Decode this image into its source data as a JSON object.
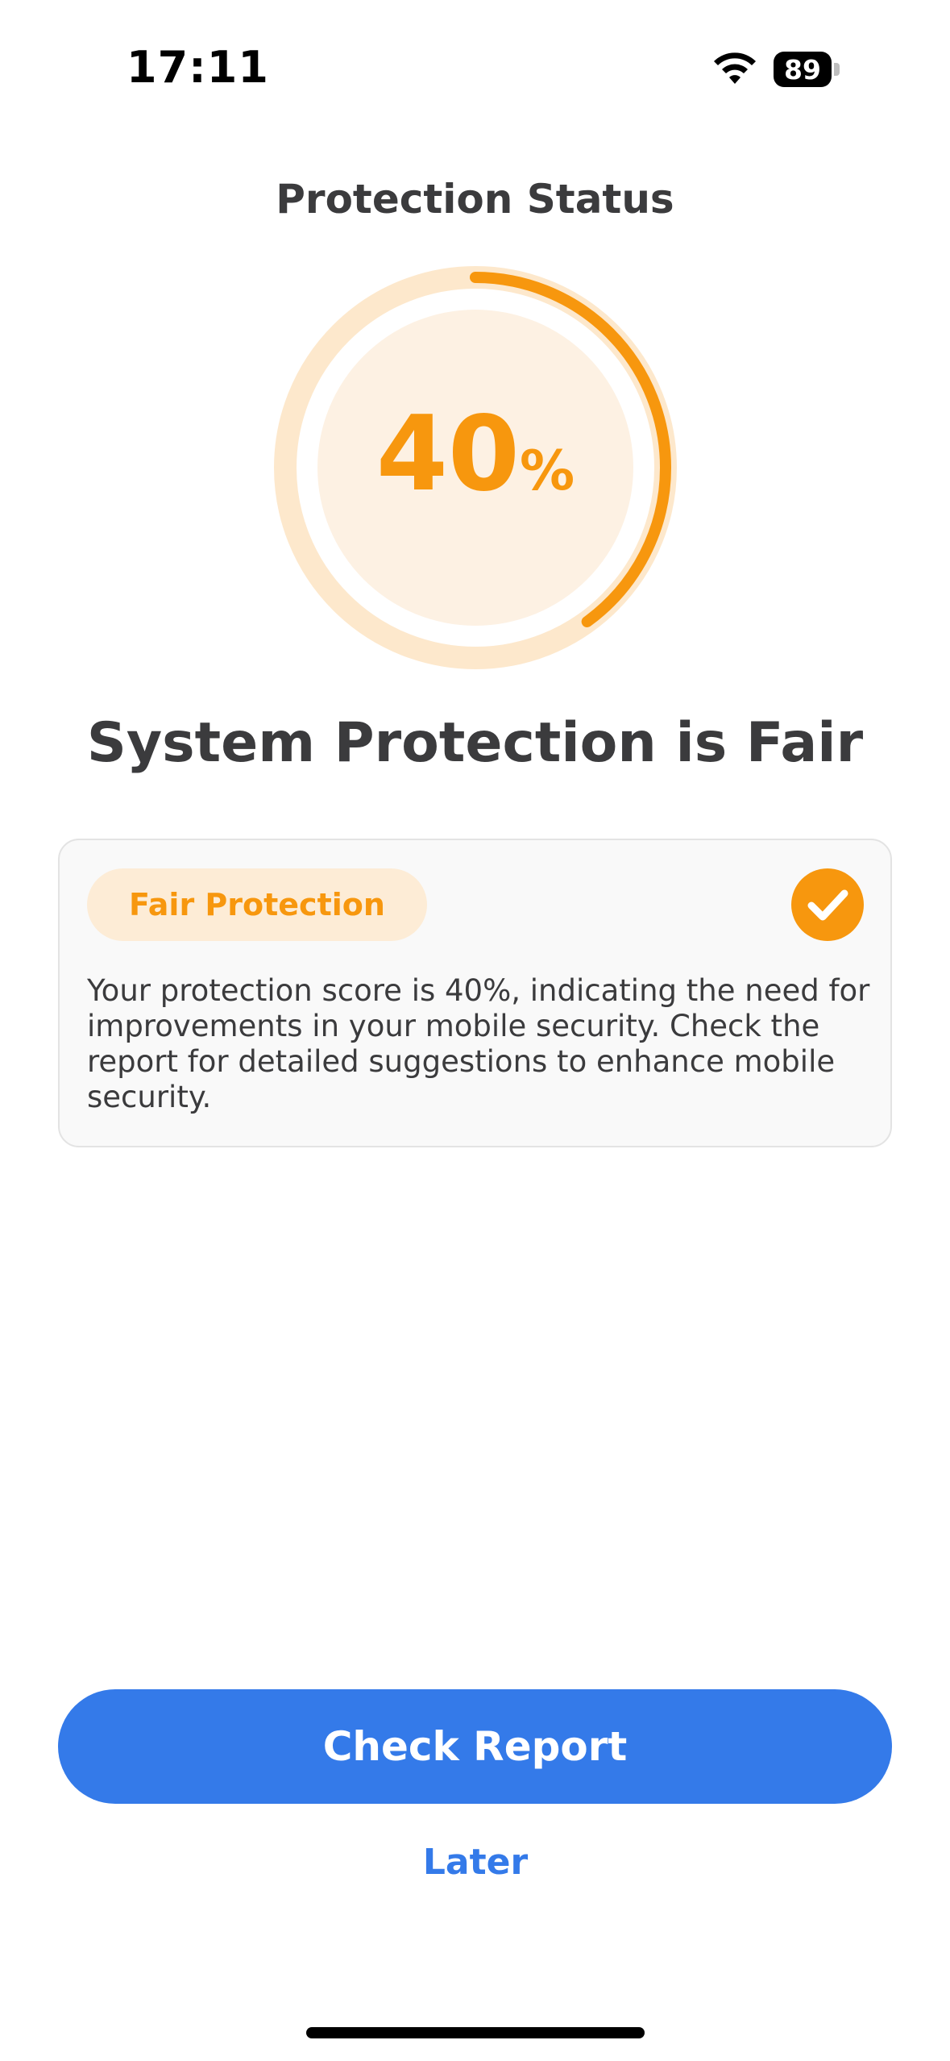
{
  "status_bar": {
    "time": "17:11",
    "battery": "89"
  },
  "header": {
    "title": "Protection Status"
  },
  "gauge": {
    "value": "40",
    "unit": "%",
    "fraction": 0.4
  },
  "main": {
    "headline": "System Protection is Fair",
    "card": {
      "badge_label": "Fair Protection",
      "description": "Your protection score is 40%, indicating the need for improvements in your mobile security. Check the report for detailed suggestions to enhance mobile security."
    }
  },
  "actions": {
    "primary_label": "Check Report",
    "secondary_label": "Later"
  },
  "colors": {
    "accent": "#f7970e",
    "accent_light": "#fdecd6",
    "primary_button": "#347ae9"
  },
  "icons": {
    "wifi": "wifi-icon",
    "battery": "battery-icon",
    "check": "check-circle-icon"
  }
}
